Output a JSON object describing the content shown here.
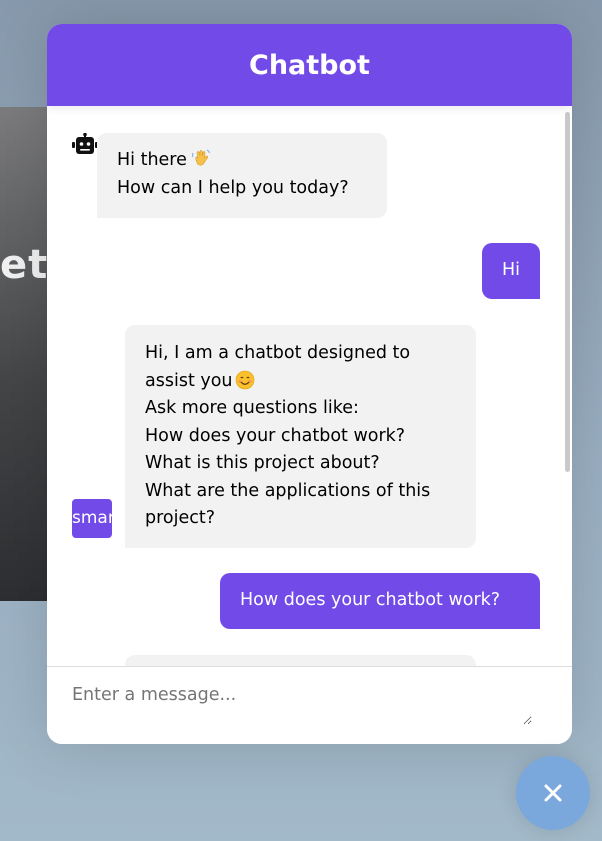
{
  "background": {
    "text": "et"
  },
  "chatbot": {
    "title": "Chatbot",
    "messages": [
      {
        "type": "incoming",
        "line1": "Hi there",
        "line2": "How can I help you today?",
        "emoji": "waving-hand"
      },
      {
        "type": "outgoing",
        "text": "Hi"
      },
      {
        "type": "incoming",
        "line1": "Hi, I am a chatbot designed to",
        "line2": "assist you",
        "emoji": "smiling-face",
        "rest": "Ask more questions like:\nHow does your chatbot work?\nWhat is this project about?\nWhat are the applications of this project?"
      },
      {
        "type": "outgoing",
        "text": "How does your chatbot work?"
      },
      {
        "type": "incoming",
        "text": ""
      }
    ],
    "avatar_fallback_text": "smart_toy",
    "input": {
      "placeholder": "Enter a message..."
    }
  },
  "toggler": {
    "icon": "close-icon"
  },
  "colors": {
    "accent": "#724ae8",
    "incoming_bg": "#f2f2f2",
    "toggler": "#7aa7dc"
  }
}
